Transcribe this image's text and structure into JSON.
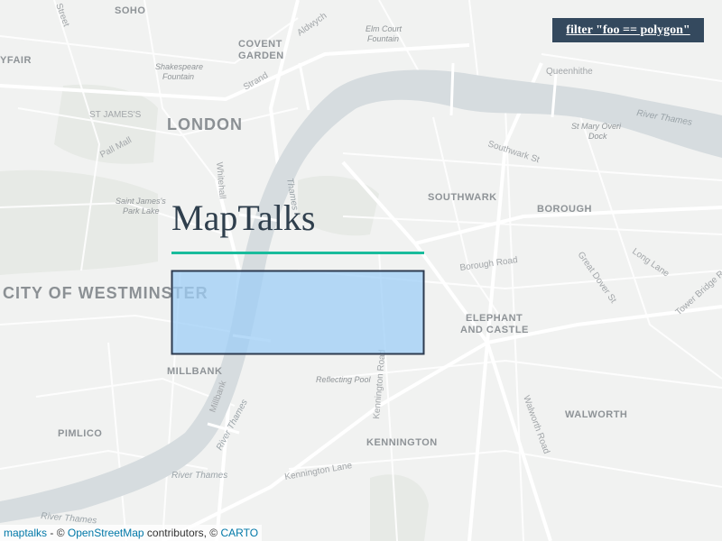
{
  "controls": {
    "filter_button": "filter \"foo == polygon\""
  },
  "overlay": {
    "title": "MapTalks",
    "polygon": {
      "fill": "#9ecef5",
      "stroke": "#2d3b50"
    }
  },
  "attribution": {
    "maptalks": "maptalks",
    "sep1": " - © ",
    "osm": "OpenStreetMap",
    "sep2": " contributors, © ",
    "carto": "CARTO"
  },
  "map_labels": {
    "soho": "SOHO",
    "mayfair": "YFAIR",
    "covent_garden_1": "COVENT",
    "covent_garden_2": "GARDEN",
    "elm_court_1": "Elm Court",
    "elm_court_2": "Fountain",
    "shakespeare_1": "Shakespeare",
    "shakespeare_2": "Fountain",
    "st_james": "ST JAMES'S",
    "london": "LONDON",
    "strand": "Strand",
    "aldwych": "Aldwych",
    "queenhithe": "Queenhithe",
    "st_mary_1": "St Mary Overi",
    "st_mary_2": "Dock",
    "river_thames_ne": "River Thames",
    "pall_mall": "Pall Mall",
    "whitehall": "Whitehall",
    "thames_centre": "Thames",
    "southwark_st": "Southwark St",
    "southwark": "SOUTHWARK",
    "borough": "BOROUGH",
    "st_james_park_1": "Saint James's",
    "st_james_park_2": "Park Lake",
    "borough_road": "Borough Road",
    "long_lane": "Long Lane",
    "great_dover": "Great Dover St",
    "tower_bridge": "Tower Bridge Rd",
    "westminster": "CITY OF WESTMINSTER",
    "elephant_1": "ELEPHANT",
    "elephant_2": "AND CASTLE",
    "millbank": "MILLBANK",
    "millbank_road": "Millbank",
    "river_thames_sw": "River Thames",
    "reflecting_pool": "Reflecting Pool",
    "kennington_road": "Kennington Road",
    "walworth_road": "Walworth Road",
    "walworth": "WALWORTH",
    "pimlico": "PIMLICO",
    "kennington": "KENNINGTON",
    "kennington_lane": "Kennington Lane",
    "river_thames_s": "River Thames",
    "river_thames_bottom": "River Thames",
    "street_top_left": "Street"
  }
}
